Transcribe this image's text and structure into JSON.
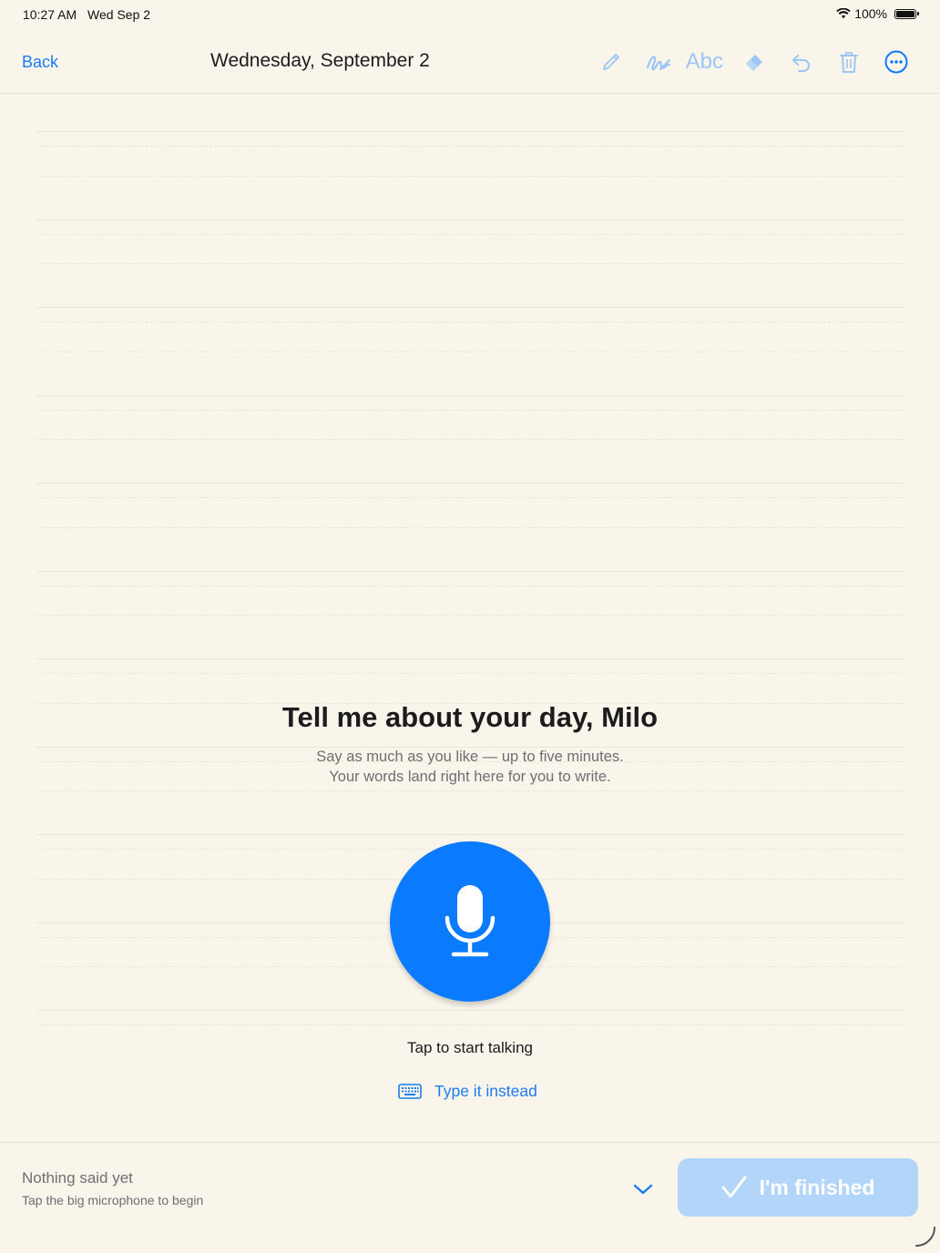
{
  "status_bar": {
    "time": "10:27 AM",
    "date": "Wed Sep 2",
    "battery": "100%"
  },
  "nav": {
    "back_label": "Back",
    "title": "Wednesday, September 2",
    "tools": {
      "pen": "pencil-icon",
      "handwriting": "scribble-icon",
      "text_label": "Abc",
      "eraser": "eraser-icon",
      "undo": "undo-icon",
      "trash": "trash-icon",
      "more": "more-icon"
    }
  },
  "prompt": {
    "title": "Tell me about your day, Milo",
    "subtitle_line1": "Say as much as you like — up to five minutes.",
    "subtitle_line2": "Your words land right here for you to write."
  },
  "mic": {
    "icon": "microphone-icon",
    "label": "Tap to start talking"
  },
  "type_instead": {
    "icon": "keyboard-icon",
    "label": "Type it instead"
  },
  "bottom": {
    "status_title": "Nothing said yet",
    "status_hint": "Tap the big microphone to begin",
    "finish_label": "I'm finished"
  },
  "colors": {
    "accent": "#0a7aff",
    "link": "#1a7cf0",
    "disabled_tint": "#9cc6f4",
    "finish_disabled": "#b3d5f9",
    "paper": "#faf5eb"
  }
}
